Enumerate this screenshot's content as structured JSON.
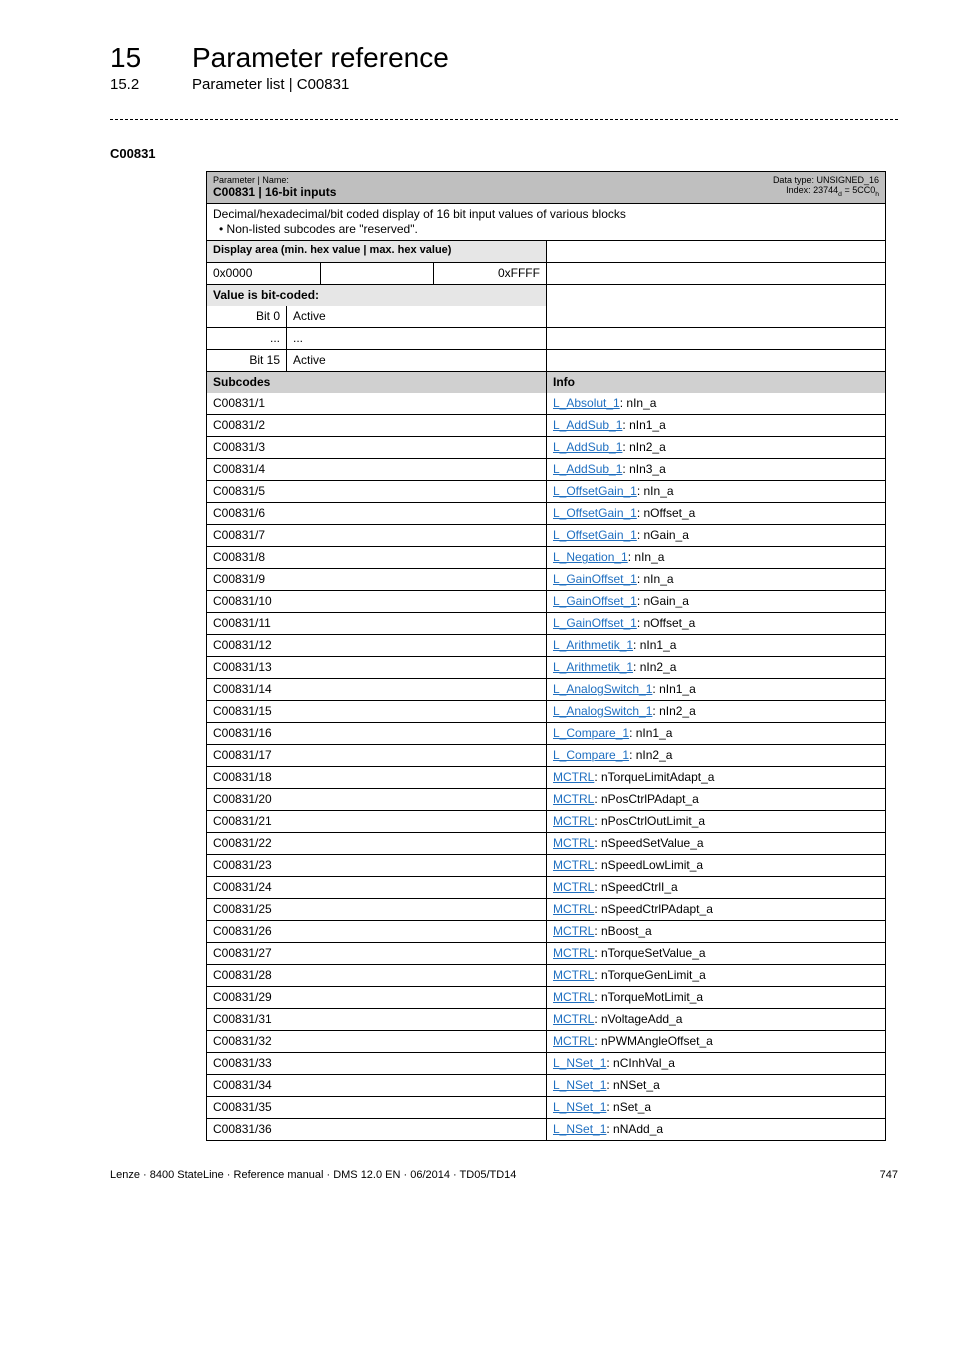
{
  "header": {
    "section_num": "15",
    "section_title": "Parameter reference",
    "subsection_num": "15.2",
    "subsection_title": "Parameter list | C00831"
  },
  "code_label": "C00831",
  "param_header": {
    "param_name_label": "Parameter | Name:",
    "param_name_value": "C00831 | 16-bit inputs",
    "data_type_line1": "Data type: UNSIGNED_16",
    "data_type_line2_prefix": "Index: 23744",
    "data_type_line2_sub1": "d",
    "data_type_line2_mid": " = 5CC0",
    "data_type_line2_sub2": "h"
  },
  "description": "Decimal/hexadecimal/bit coded display of 16 bit input values of various blocks",
  "description_bullet": "• Non-listed subcodes are \"reserved\".",
  "display_area_label": "Display area (min. hex value | max. hex value)",
  "display_area": {
    "min": "0x0000",
    "mid": "",
    "max": "0xFFFF"
  },
  "value_bit_coded_label": "Value is bit-coded:",
  "bits": [
    {
      "label": "Bit 0",
      "value": "Active"
    },
    {
      "label": "...",
      "value": "..."
    },
    {
      "label": "Bit 15",
      "value": "Active"
    }
  ],
  "subcodes_header_left": "Subcodes",
  "subcodes_header_right": "Info",
  "rows": [
    {
      "sub": "C00831/1",
      "link": "L_Absolut_1",
      "suffix": ": nIn_a"
    },
    {
      "sub": "C00831/2",
      "link": "L_AddSub_1",
      "suffix": ": nIn1_a"
    },
    {
      "sub": "C00831/3",
      "link": "L_AddSub_1",
      "suffix": ": nIn2_a"
    },
    {
      "sub": "C00831/4",
      "link": "L_AddSub_1",
      "suffix": ": nIn3_a"
    },
    {
      "sub": "C00831/5",
      "link": "L_OffsetGain_1",
      "suffix": ": nIn_a"
    },
    {
      "sub": "C00831/6",
      "link": "L_OffsetGain_1",
      "suffix": ": nOffset_a"
    },
    {
      "sub": "C00831/7",
      "link": "L_OffsetGain_1",
      "suffix": ": nGain_a"
    },
    {
      "sub": "C00831/8",
      "link": "L_Negation_1",
      "suffix": ": nIn_a"
    },
    {
      "sub": "C00831/9",
      "link": "L_GainOffset_1",
      "suffix": ": nIn_a"
    },
    {
      "sub": "C00831/10",
      "link": "L_GainOffset_1",
      "suffix": ": nGain_a"
    },
    {
      "sub": "C00831/11",
      "link": "L_GainOffset_1",
      "suffix": ": nOffset_a"
    },
    {
      "sub": "C00831/12",
      "link": "L_Arithmetik_1",
      "suffix": ": nIn1_a"
    },
    {
      "sub": "C00831/13",
      "link": "L_Arithmetik_1",
      "suffix": ": nIn2_a"
    },
    {
      "sub": "C00831/14",
      "link": "L_AnalogSwitch_1",
      "suffix": ": nIn1_a"
    },
    {
      "sub": "C00831/15",
      "link": "L_AnalogSwitch_1",
      "suffix": ": nIn2_a"
    },
    {
      "sub": "C00831/16",
      "link": "L_Compare_1",
      "suffix": ": nIn1_a"
    },
    {
      "sub": "C00831/17",
      "link": "L_Compare_1",
      "suffix": ": nIn2_a"
    },
    {
      "sub": "C00831/18",
      "link": "MCTRL",
      "suffix": ": nTorqueLimitAdapt_a"
    },
    {
      "sub": "C00831/20",
      "link": "MCTRL",
      "suffix": ": nPosCtrlPAdapt_a"
    },
    {
      "sub": "C00831/21",
      "link": "MCTRL",
      "suffix": ": nPosCtrlOutLimit_a"
    },
    {
      "sub": "C00831/22",
      "link": "MCTRL",
      "suffix": ": nSpeedSetValue_a"
    },
    {
      "sub": "C00831/23",
      "link": "MCTRL",
      "suffix": ": nSpeedLowLimit_a"
    },
    {
      "sub": "C00831/24",
      "link": "MCTRL",
      "suffix": ": nSpeedCtrlI_a"
    },
    {
      "sub": "C00831/25",
      "link": "MCTRL",
      "suffix": ": nSpeedCtrlPAdapt_a"
    },
    {
      "sub": "C00831/26",
      "link": "MCTRL",
      "suffix": ": nBoost_a"
    },
    {
      "sub": "C00831/27",
      "link": "MCTRL",
      "suffix": ": nTorqueSetValue_a"
    },
    {
      "sub": "C00831/28",
      "link": "MCTRL",
      "suffix": ": nTorqueGenLimit_a"
    },
    {
      "sub": "C00831/29",
      "link": "MCTRL",
      "suffix": ": nTorqueMotLimit_a"
    },
    {
      "sub": "C00831/31",
      "link": "MCTRL",
      "suffix": ": nVoltageAdd_a"
    },
    {
      "sub": "C00831/32",
      "link": "MCTRL",
      "suffix": ": nPWMAngleOffset_a"
    },
    {
      "sub": "C00831/33",
      "link": "L_NSet_1",
      "suffix": ": nCInhVal_a"
    },
    {
      "sub": "C00831/34",
      "link": "L_NSet_1",
      "suffix": ": nNSet_a"
    },
    {
      "sub": "C00831/35",
      "link": "L_NSet_1",
      "suffix": ": nSet_a"
    },
    {
      "sub": "C00831/36",
      "link": "L_NSet_1",
      "suffix": ": nNAdd_a"
    }
  ],
  "footer": {
    "left": "Lenze · 8400 StateLine · Reference manual · DMS 12.0 EN · 06/2014 · TD05/TD14",
    "right": "747"
  }
}
